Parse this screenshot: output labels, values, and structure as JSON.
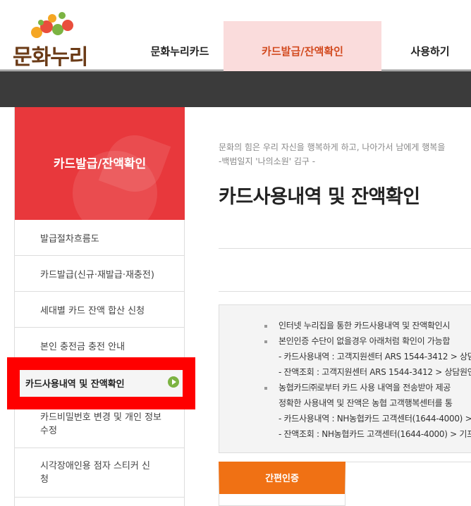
{
  "header": {
    "logo_text": "문화누리",
    "nav": [
      "문화누리카드",
      "카드발급/잔액확인",
      "사용하기"
    ]
  },
  "sidebar": {
    "title": "카드발급/잔액확인",
    "items": [
      "발급절차흐름도",
      "카드발급(신규·재발급·재충전)",
      "세대별 카드 잔액 합산 신청",
      "본인 충전금 충전 안내",
      "카드사용내역 및 잔액확인",
      "카드비밀번호 변경 및 개인 정보수정",
      "시각장애인용 점자 스티커 신청"
    ]
  },
  "main": {
    "quote_line1": "문화의 힘은 우리 자신을 행복하게 하고, 나아가서 남에게 행복을",
    "quote_line2": "-백범일지 '나의소원' 김구 -",
    "title": "카드사용내역 및 잔액확인",
    "info": [
      "인터넷 누리집을 통한 카드사용내역 및 잔액확인시",
      "본인인증 수단이 없을경우 아래처럼 확인이 가능합",
      "- 카드사용내역 : 고객지원센터 ARS 1544-3412 > 상담",
      "- 잔액조회 : 고객지원센터 ARS 1544-3412 > 상담원연",
      "농협카드㈜로부터 카드 사용 내역을 전송받아 제공",
      "정확한 사용내역 및 잔액은 농협 고객행복센터를 통",
      "- 카드사용내역 : NH농협카드 고객센터(1644-4000) >",
      "- 잔액조회 : NH농협카드 고객센터(1644-4000) > 기프"
    ],
    "tab_label": "간편인증"
  }
}
